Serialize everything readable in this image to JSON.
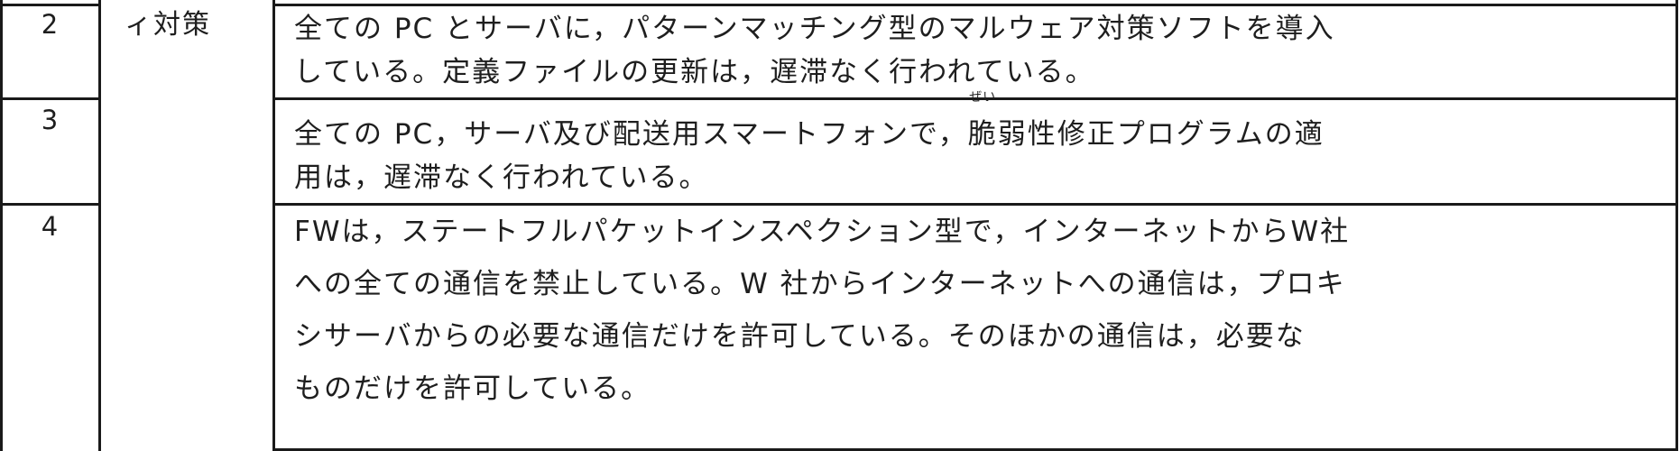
{
  "table": {
    "category": "ィ対策",
    "rows": [
      {
        "number": "2",
        "lines": [
          "全ての PC とサーバに，パターンマッチング型のマルウェア対策ソフトを導入",
          "している。定義ファイルの更新は，遅滞なく行われている。"
        ]
      },
      {
        "number": "3",
        "line1_before": "全ての PC，サーバ及び配送用スマートフォンで，",
        "ruby_base": "脆",
        "ruby_reading": "ぜい",
        "line1_after": "弱性修正プログラムの適",
        "line2": "用は，遅滞なく行われている。"
      },
      {
        "number": "4",
        "lines": [
          "FWは，ステートフルパケットインスペクション型で，インターネットからW社",
          "への全ての通信を禁止している。W 社からインターネットへの通信は，プロキ",
          "シサーバからの必要な通信だけを許可している。そのほかの通信は，必要な",
          "ものだけを許可している。"
        ]
      }
    ]
  }
}
